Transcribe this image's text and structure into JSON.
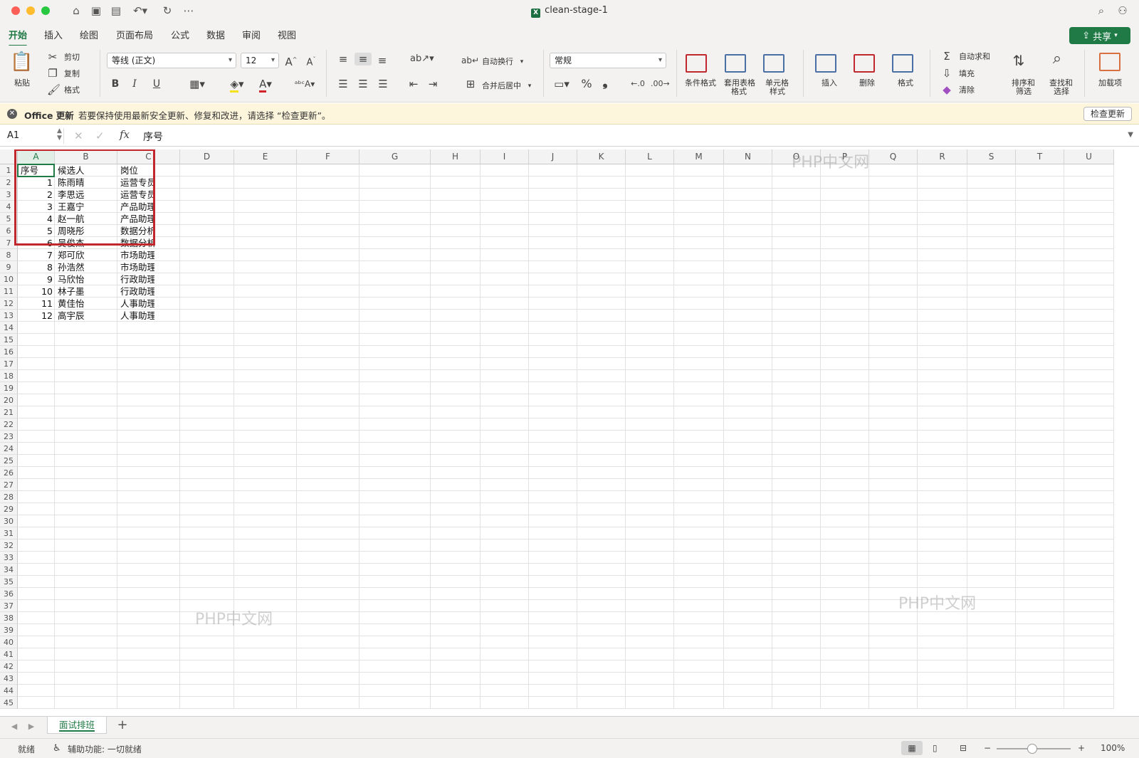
{
  "window": {
    "title": "clean-stage-1",
    "quick_access_icons": [
      "home-icon",
      "save-icon",
      "save-as-icon",
      "undo-icon",
      "redo-icon",
      "more-icon"
    ]
  },
  "ribbon_tabs": [
    "开始",
    "插入",
    "绘图",
    "页面布局",
    "公式",
    "数据",
    "审阅",
    "视图"
  ],
  "share_label": "共享",
  "ribbon": {
    "paste": "粘贴",
    "cut": "剪切",
    "copy": "复制",
    "format_painter": "格式",
    "font_name": "等线 (正文)",
    "font_size": "12",
    "wrap_text": "自动换行",
    "merge_center": "合并后居中",
    "number_format": "常规",
    "conditional_format": "条件格式",
    "table_format_1": "套用表格",
    "table_format_2": "格式",
    "cell_style_1": "单元格",
    "cell_style_2": "样式",
    "insert": "插入",
    "delete": "删除",
    "format": "格式",
    "autosum": "自动求和",
    "fill": "填充",
    "clear": "清除",
    "sort_1": "排序和",
    "sort_2": "筛选",
    "find_1": "查找和",
    "find_2": "选择",
    "addins": "加载项"
  },
  "message_bar": {
    "title": "Office 更新",
    "text": "若要保持使用最新安全更新、修复和改进，请选择 “检查更新”。",
    "button": "检查更新"
  },
  "formula_bar": {
    "name_box": "A1",
    "fx": "fx",
    "value": "序号"
  },
  "columns": [
    "A",
    "B",
    "C",
    "D",
    "E",
    "F",
    "G",
    "H",
    "I",
    "J",
    "K",
    "L",
    "M",
    "N",
    "O",
    "P",
    "Q",
    "R",
    "S",
    "T",
    "U"
  ],
  "table": {
    "headers": [
      "序号",
      "候选人",
      "岗位"
    ],
    "rows": [
      [
        "1",
        "陈雨晴",
        "运营专员"
      ],
      [
        "2",
        "李思远",
        "运营专员"
      ],
      [
        "3",
        "王嘉宁",
        "产品助理"
      ],
      [
        "4",
        "赵一航",
        "产品助理"
      ],
      [
        "5",
        "周晓彤",
        "数据分析"
      ],
      [
        "6",
        "吴俊杰",
        "数据分析"
      ],
      [
        "7",
        "郑可欣",
        "市场助理"
      ],
      [
        "8",
        "孙浩然",
        "市场助理"
      ],
      [
        "9",
        "马欣怡",
        "行政助理"
      ],
      [
        "10",
        "林子墨",
        "行政助理"
      ],
      [
        "11",
        "黄佳怡",
        "人事助理"
      ],
      [
        "12",
        "高宇辰",
        "人事助理"
      ]
    ]
  },
  "visible_rows": 45,
  "watermarks": [
    "PHP中文网",
    "PHP中文网",
    "PHP中文网"
  ],
  "sheet_tabs": [
    "面试排班"
  ],
  "add_sheet": "+",
  "status": {
    "ready": "就绪",
    "accessibility": "辅助功能: 一切就绪",
    "zoom": "100%"
  },
  "colors": {
    "accent": "#1f7a45",
    "highlight_box": "#c0282d",
    "message_bar_bg": "#fdf5dc"
  }
}
